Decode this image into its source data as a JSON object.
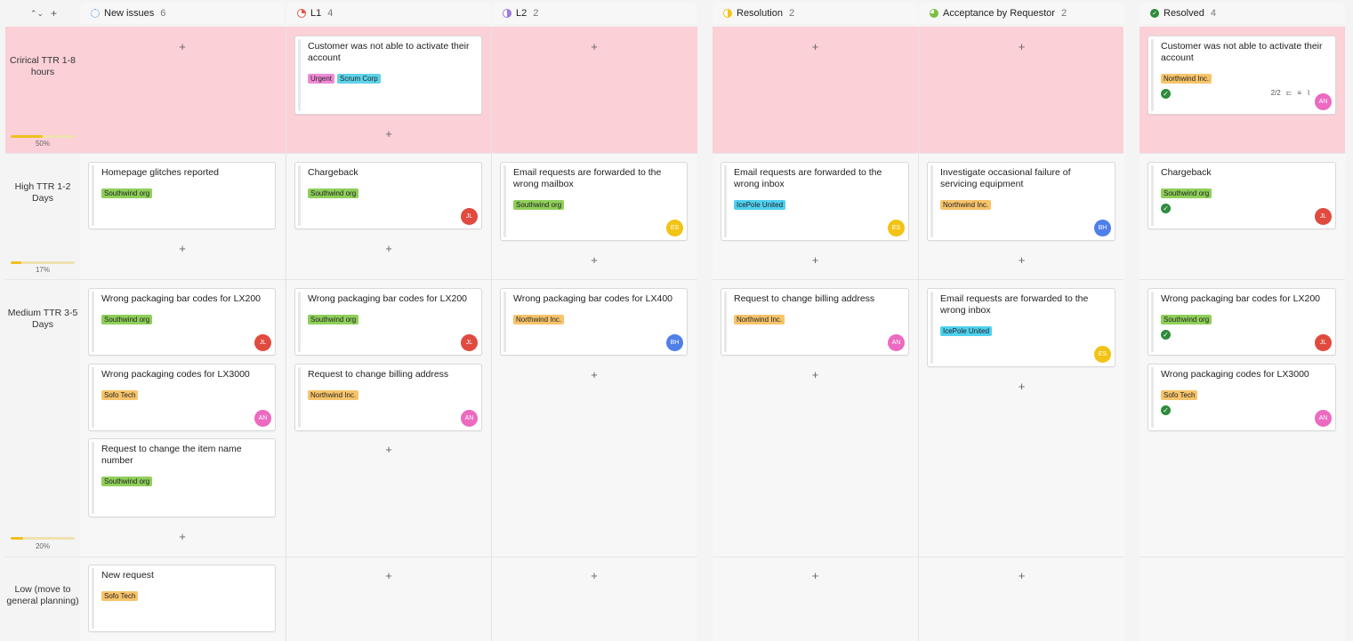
{
  "toolbar": {
    "collapse": "⌃⌄",
    "add": "+"
  },
  "colors": {
    "critical_bg": "#fbd0d7",
    "progress": "#f0c020"
  },
  "columns": [
    {
      "title": "New issues",
      "count": "6",
      "status_icon": "dotted-circle-icon",
      "color": "#4a90e2"
    },
    {
      "title": "L1",
      "count": "4",
      "status_icon": "quarter-circle-icon",
      "color": "#e2574c"
    },
    {
      "title": "L2",
      "count": "2",
      "status_icon": "half-circle-icon",
      "color": "#9b7be0"
    },
    {
      "title": "Resolution",
      "count": "2",
      "status_icon": "half-circle-icon",
      "color": "#f5c518"
    },
    {
      "title": "Acceptance by Requestor",
      "count": "2",
      "status_icon": "three-quarter-circle-icon",
      "color": "#7ac143"
    },
    {
      "title": "Resolved",
      "count": "4",
      "status_icon": "check-circle-icon",
      "color": "#2e8b3c"
    }
  ],
  "rows": [
    {
      "label": "Crirical TTR 1-8 hours",
      "progress": 0.5,
      "progress_text": "50%"
    },
    {
      "label": "High TTR 1-2 Days",
      "progress": 0.17,
      "progress_text": "17%"
    },
    {
      "label": "Medium TTR 3-5 Days",
      "progress": 0.2,
      "progress_text": "20%"
    },
    {
      "label": "Low (move to general planning)"
    }
  ],
  "tag_colors": {
    "Urgent": "#f08bd6",
    "Scrum Corp": "#5ed3ea",
    "Northwind Inc.": "#f7c46b",
    "Southwind org": "#8fcf5a",
    "IcePole United": "#4fd0ef",
    "Sofo Tech": "#f7c46b"
  },
  "avatar_colors": {
    "JL": "#e04a3f",
    "ES": "#f2c314",
    "BH": "#4f7fe8",
    "AN": "#ec6ac0"
  },
  "cards": [
    {
      "title": "Customer was not able to activate their account",
      "tags": [
        "Urgent",
        "Scrum Corp"
      ]
    },
    {
      "title": "Customer was not able to activate their account",
      "tags": [
        "Northwind Inc."
      ],
      "avatar": "AN",
      "done": true,
      "meta": "2/2"
    },
    {
      "title": "Homepage glitches reported",
      "tags": [
        "Southwind org"
      ]
    },
    {
      "title": "Chargeback",
      "tags": [
        "Southwind org"
      ],
      "avatar": "JL"
    },
    {
      "title": "Email requests are forwarded to the wrong mailbox",
      "tags": [
        "Southwind org"
      ],
      "avatar": "ES"
    },
    {
      "title": "Email requests are forwarded to the wrong inbox",
      "tags": [
        "IcePole United"
      ],
      "avatar": "ES"
    },
    {
      "title": "Investigate occasional failure of servicing equipment",
      "tags": [
        "Northwind Inc."
      ],
      "avatar": "BH"
    },
    {
      "title": "Chargeback",
      "tags": [
        "Southwind org"
      ],
      "avatar": "JL",
      "done": true
    },
    {
      "title": "Wrong packaging bar codes for LX200",
      "tags": [
        "Southwind org"
      ],
      "avatar": "JL"
    },
    {
      "title": "Wrong packaging codes for LX3000",
      "tags": [
        "Sofo Tech"
      ],
      "avatar": "AN"
    },
    {
      "title": "Request to change the item name number",
      "tags": [
        "Southwind org"
      ]
    },
    {
      "title": "Wrong packaging bar codes for LX200",
      "tags": [
        "Southwind org"
      ],
      "avatar": "JL"
    },
    {
      "title": "Request to change billing address",
      "tags": [
        "Northwind Inc."
      ],
      "avatar": "AN"
    },
    {
      "title": "Wrong packaging bar codes for LX400",
      "tags": [
        "Northwind Inc."
      ],
      "avatar": "BH"
    },
    {
      "title": "Request to change billing address",
      "tags": [
        "Northwind Inc."
      ],
      "avatar": "AN"
    },
    {
      "title": "Email requests are forwarded to the wrong inbox",
      "tags": [
        "IcePole United"
      ],
      "avatar": "ES"
    },
    {
      "title": "Wrong packaging bar codes for LX200",
      "tags": [
        "Southwind org"
      ],
      "avatar": "JL",
      "done": true
    },
    {
      "title": "Wrong packaging codes for LX3000",
      "tags": [
        "Sofo Tech"
      ],
      "avatar": "AN",
      "done": true
    },
    {
      "title": "New request",
      "tags": [
        "Sofo Tech"
      ]
    }
  ],
  "add_label": "+"
}
